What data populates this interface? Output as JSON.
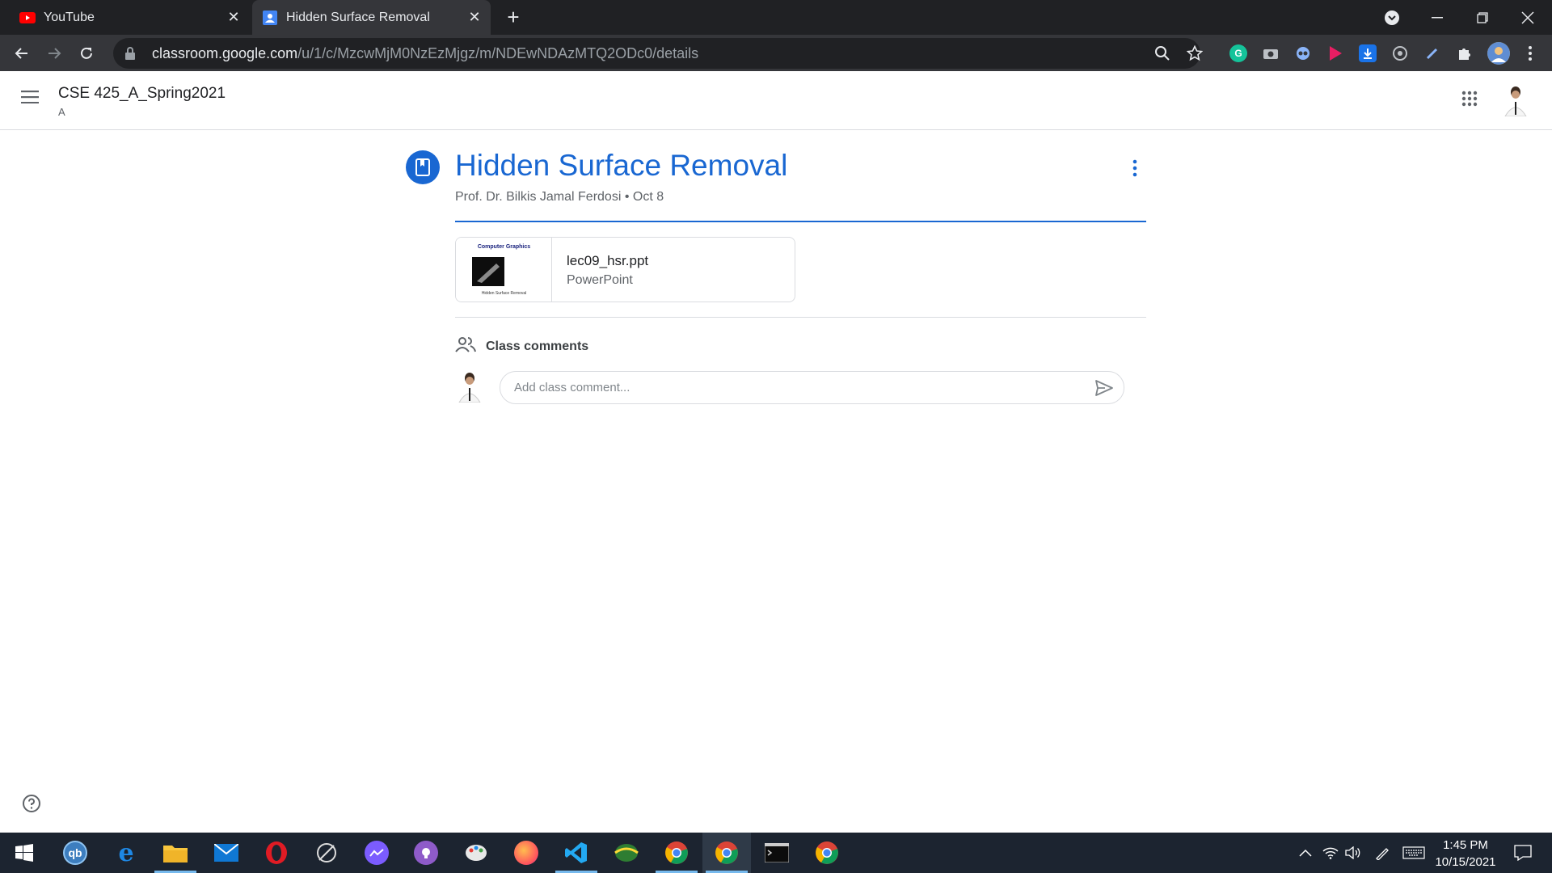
{
  "browser": {
    "tabs": [
      {
        "label": "YouTube",
        "active": false
      },
      {
        "label": "Hidden Surface Removal",
        "active": true
      }
    ],
    "url_host": "classroom.google.com",
    "url_path": "/u/1/c/MzcwMjM0NzEzMjgz/m/NDEwNDAzMTQ2ODc0/details"
  },
  "app": {
    "course_title": "CSE 425_A_Spring2021",
    "course_section": "A"
  },
  "material": {
    "title": "Hidden Surface Removal",
    "author": "Prof. Dr. Bilkis Jamal Ferdosi",
    "separator": "•",
    "date": "Oct 8",
    "attachment": {
      "thumb_title": "Computer Graphics",
      "thumb_caption": "Hidden Surface Removal",
      "name": "lec09_hsr.ppt",
      "type": "PowerPoint"
    }
  },
  "comments": {
    "heading": "Class comments",
    "placeholder": "Add class comment..."
  },
  "taskbar": {
    "time": "1:45 PM",
    "date": "10/15/2021"
  },
  "colors": {
    "accent": "#1967d2",
    "chrome_dark": "#202124",
    "chrome_toolbar": "#35363a",
    "taskbar": "#1c2430"
  }
}
